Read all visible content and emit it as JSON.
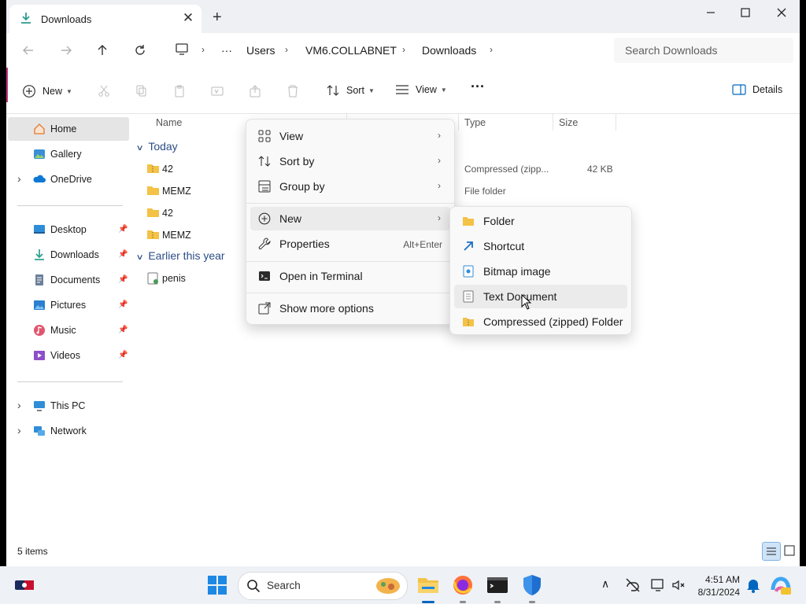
{
  "window": {
    "tab_title": "Downloads",
    "new_tab": "+",
    "controls": [
      "minimize-icon",
      "maximize-icon",
      "close-icon"
    ]
  },
  "address": {
    "breadcrumbs": [
      "Users",
      "VM6.COLLABNET",
      "Downloads"
    ],
    "overflow": "···",
    "search_placeholder": "Search Downloads"
  },
  "toolbar": {
    "new_label": "New",
    "sort_label": "Sort",
    "view_label": "View",
    "more_label": "···",
    "details_label": "Details"
  },
  "sidebar": {
    "items": [
      {
        "label": "Home",
        "icon": "home-icon",
        "pinned": false
      },
      {
        "label": "Gallery",
        "icon": "gallery-icon",
        "pinned": false
      },
      {
        "label": "OneDrive",
        "icon": "onedrive-icon",
        "pinned": false
      },
      {
        "label": "Desktop",
        "icon": "desktop-icon",
        "pinned": true
      },
      {
        "label": "Downloads",
        "icon": "download-icon",
        "pinned": true
      },
      {
        "label": "Documents",
        "icon": "documents-icon",
        "pinned": true
      },
      {
        "label": "Pictures",
        "icon": "pictures-icon",
        "pinned": true
      },
      {
        "label": "Music",
        "icon": "music-icon",
        "pinned": true
      },
      {
        "label": "Videos",
        "icon": "videos-icon",
        "pinned": true
      },
      {
        "label": "This PC",
        "icon": "pc-icon",
        "pinned": false
      },
      {
        "label": "Network",
        "icon": "network-icon",
        "pinned": false
      }
    ]
  },
  "columns": {
    "name": "Name",
    "type": "Type",
    "size": "Size"
  },
  "groups": [
    {
      "label": "Today",
      "files": [
        {
          "name": "42",
          "icon": "zip-folder-icon"
        },
        {
          "name": "MEMZ",
          "icon": "folder-icon"
        },
        {
          "name": "42",
          "icon": "folder-icon"
        },
        {
          "name": "MEMZ",
          "icon": "zip-folder-icon"
        }
      ]
    },
    {
      "label": "Earlier this year",
      "files": [
        {
          "name": "penis",
          "icon": "file-icon"
        }
      ]
    }
  ],
  "visible_details": {
    "row1_type": "Compressed (zipp...",
    "row1_size": "42 KB",
    "row2_type": "File folder"
  },
  "context_menu": {
    "items": [
      {
        "label": "View",
        "icon": "view-grid-icon",
        "arrow": "›"
      },
      {
        "label": "Sort by",
        "icon": "sort-icon",
        "arrow": "›"
      },
      {
        "label": "Group by",
        "icon": "group-icon",
        "arrow": "›"
      },
      {
        "label": "New",
        "icon": "new-plus-icon",
        "arrow": "›"
      },
      {
        "label": "Properties",
        "icon": "properties-icon",
        "shortcut": "Alt+Enter"
      },
      {
        "label": "Open in Terminal",
        "icon": "terminal-icon"
      },
      {
        "label": "Show more options",
        "icon": "more-options-icon"
      }
    ]
  },
  "new_submenu": {
    "items": [
      {
        "label": "Folder",
        "icon": "folder-icon"
      },
      {
        "label": "Shortcut",
        "icon": "shortcut-icon"
      },
      {
        "label": "Bitmap image",
        "icon": "bitmap-icon"
      },
      {
        "label": "Text Document",
        "icon": "text-document-icon"
      },
      {
        "label": "Compressed (zipped) Folder",
        "icon": "zip-folder-icon"
      }
    ]
  },
  "status": {
    "item_count": "5 items"
  },
  "taskbar": {
    "search_label": "Search",
    "time": "4:51 AM",
    "date": "8/31/2024"
  },
  "colors": {
    "accent": "#0067c0",
    "folder": "#f3c247",
    "highlight": "#ebebeb"
  }
}
